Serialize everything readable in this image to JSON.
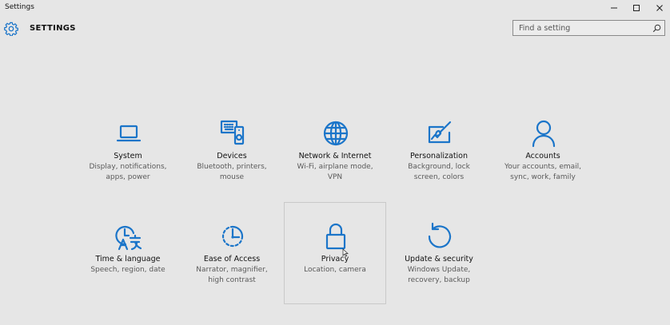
{
  "window": {
    "title": "Settings",
    "controls": [
      "minimize",
      "maximize",
      "close"
    ]
  },
  "header": {
    "icon": "gear-icon",
    "title": "SETTINGS"
  },
  "search": {
    "placeholder": "Find a setting",
    "value": "",
    "icon": "search-icon"
  },
  "accent_color": "#1b75c9",
  "categories": [
    {
      "label": "System",
      "desc1": "Display, notifications,",
      "desc2": "apps, power",
      "desc3": "",
      "icon": "laptop-icon"
    },
    {
      "label": "Devices",
      "desc1": "Bluetooth, printers,",
      "desc2": "mouse",
      "desc3": "",
      "icon": "devices-icon"
    },
    {
      "label": "Network & Internet",
      "desc1": "Wi-Fi, airplane mode,",
      "desc2": "VPN",
      "desc3": "",
      "icon": "globe-icon"
    },
    {
      "label": "Personalization",
      "desc1": "Background, lock",
      "desc2": "screen, colors",
      "desc3": "",
      "icon": "paint-brush-icon"
    },
    {
      "label": "Accounts",
      "desc1": "Your accounts, email,",
      "desc2": "sync, work, family",
      "desc3": "",
      "icon": "person-icon"
    },
    {
      "label": "Time & language",
      "desc1": "Speech, region, date",
      "desc2": "",
      "desc3": "",
      "icon": "time-language-icon"
    },
    {
      "label": "Ease of Access",
      "desc1": "Narrator, magnifier,",
      "desc2": "high contrast",
      "desc3": "",
      "icon": "ease-of-access-icon"
    },
    {
      "label": "Privacy",
      "desc1": "Location, camera",
      "desc2": "",
      "desc3": "",
      "icon": "lock-icon"
    },
    {
      "label": "Update & security",
      "desc1": "Windows Update,",
      "desc2": "recovery, backup",
      "desc3": "",
      "icon": "refresh-icon"
    }
  ]
}
